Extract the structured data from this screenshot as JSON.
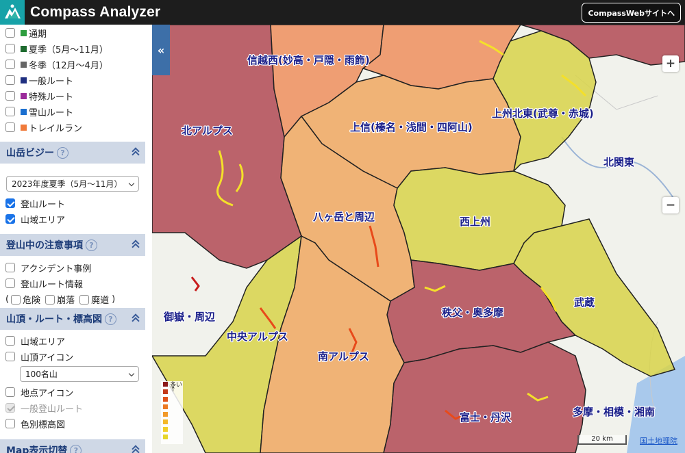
{
  "app": {
    "title": "Compass Analyzer",
    "web_button": "CompassWebサイトへ"
  },
  "route_types": [
    {
      "label": "通期",
      "color": "#2e9e3f"
    },
    {
      "label": "夏季（5月〜11月）",
      "color": "#1e6b2f"
    },
    {
      "label": "冬季（12月〜4月）",
      "color": "#666666"
    },
    {
      "label": "一般ルート",
      "color": "#1f2f80"
    },
    {
      "label": "特殊ルート",
      "color": "#9a2a9a"
    },
    {
      "label": "雪山ルート",
      "color": "#1a6fd0"
    },
    {
      "label": "トレイルラン",
      "color": "#f07a3a"
    }
  ],
  "busy": {
    "title": "山岳ビジー",
    "season_select": "2023年度夏季（5月〜11月）",
    "options": [
      {
        "label": "登山ルート",
        "checked": true
      },
      {
        "label": "山域エリア",
        "checked": true
      }
    ]
  },
  "caution": {
    "title": "登山中の注意事項",
    "options": [
      {
        "label": "アクシデント事例",
        "checked": false
      },
      {
        "label": "登山ルート情報",
        "checked": false
      }
    ],
    "sub": {
      "open": "(",
      "danger": "危険",
      "collapse": "崩落",
      "abandoned": "廃道",
      "close": ")"
    }
  },
  "summit": {
    "title": "山頂・ルート・標高図",
    "options": {
      "area": "山域エリア",
      "summit_icon": "山頂アイコン",
      "summit_select": "100名山",
      "point_icon": "地点アイコン",
      "general_route": "一般登山ルート",
      "elevation": "色別標高図"
    }
  },
  "map_display": {
    "title": "Map表示切替"
  },
  "map": {
    "areas": [
      {
        "label": "信越西(妙高・戸隠・雨飾)",
        "level": "high"
      },
      {
        "label": "北アルプス",
        "level": "highest"
      },
      {
        "label": "上信(榛名・浅間・四阿山)",
        "level": "mid"
      },
      {
        "label": "上州北東(武尊・赤城)",
        "level": "low"
      },
      {
        "label": "北関東",
        "level": "none"
      },
      {
        "label": "八ヶ岳と周辺",
        "level": "mid"
      },
      {
        "label": "西上州",
        "level": "low"
      },
      {
        "label": "御嶽・周辺",
        "level": "none"
      },
      {
        "label": "中央アルプス",
        "level": "low"
      },
      {
        "label": "南アルプス",
        "level": "mid"
      },
      {
        "label": "秩父・奥多摩",
        "level": "highest"
      },
      {
        "label": "武蔵",
        "level": "low"
      },
      {
        "label": "富士・丹沢",
        "level": "highest"
      },
      {
        "label": "多摩・相模・湘南",
        "level": "none"
      }
    ],
    "legend": {
      "top": "多い",
      "arrow": "↑"
    },
    "scale": "20 km",
    "attribution": "国土地理院",
    "colors": {
      "highest": "#b24a55",
      "high": "#ef8f5e",
      "mid": "#f0a862",
      "low": "#d8d34a",
      "none": "#ffffff"
    }
  }
}
